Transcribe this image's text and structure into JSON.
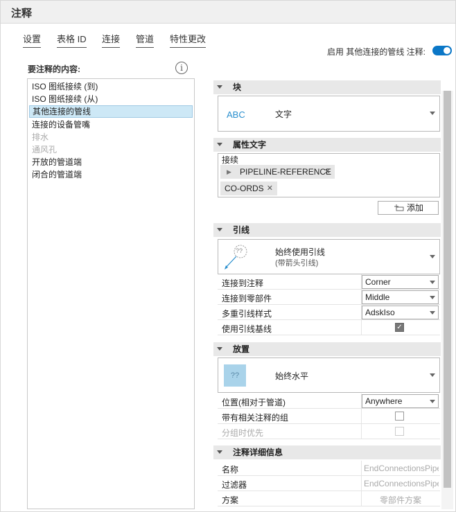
{
  "title": "注释",
  "tabs": [
    {
      "label": "设置"
    },
    {
      "label": "表格 ID"
    },
    {
      "label": "连接"
    },
    {
      "label": "管道"
    },
    {
      "label": "特性更改"
    }
  ],
  "enable_label": "启用 其他连接的管线 注释:",
  "enable_on": true,
  "content_label": "要注释的内容:",
  "list_items": [
    {
      "label": "ISO 图纸接续 (到)",
      "state": "normal"
    },
    {
      "label": "ISO 图纸接续 (从)",
      "state": "normal"
    },
    {
      "label": "其他连接的管线",
      "state": "selected"
    },
    {
      "label": "连接的设备管嘴",
      "state": "normal"
    },
    {
      "label": "排水",
      "state": "disabled"
    },
    {
      "label": "通风孔",
      "state": "disabled"
    },
    {
      "label": "开放的管道端",
      "state": "normal"
    },
    {
      "label": "闭合的管道端",
      "state": "normal"
    }
  ],
  "block": {
    "header": "块",
    "abc": "ABC",
    "value": "文字"
  },
  "attr_text": {
    "header": "属性文字",
    "label": "接续",
    "chips": [
      "PIPELINE-REFERENCE",
      "CO-ORDS"
    ],
    "add_label": "添加"
  },
  "leader": {
    "header": "引线",
    "preview_q": "??",
    "title": "始终使用引线",
    "subtitle": "(带箭头引线)",
    "rows": [
      {
        "label": "连接到注释",
        "value": "Corner"
      },
      {
        "label": "连接到零部件",
        "value": "Middle"
      },
      {
        "label": "多重引线样式",
        "value": "AdskIso"
      }
    ],
    "baseline_label": "使用引线基线",
    "baseline_checked": true
  },
  "placement": {
    "header": "放置",
    "preview_q": "??",
    "title": "始终水平",
    "position_label": "位置(相对于管道)",
    "position_value": "Anywhere",
    "group_label": "带有相关注释的组",
    "group_priority_label": "分组时优先"
  },
  "details": {
    "header": "注释详细信息",
    "rows": [
      {
        "label": "名称",
        "value": "EndConnectionsPipe"
      },
      {
        "label": "过滤器",
        "value": "EndConnectionsPipe"
      },
      {
        "label": "方案",
        "value": "零部件方案"
      }
    ]
  },
  "colors": {
    "accent": "#0b77c7",
    "selection": "#cde8f6",
    "preview_fill": "#a9d3ea"
  }
}
